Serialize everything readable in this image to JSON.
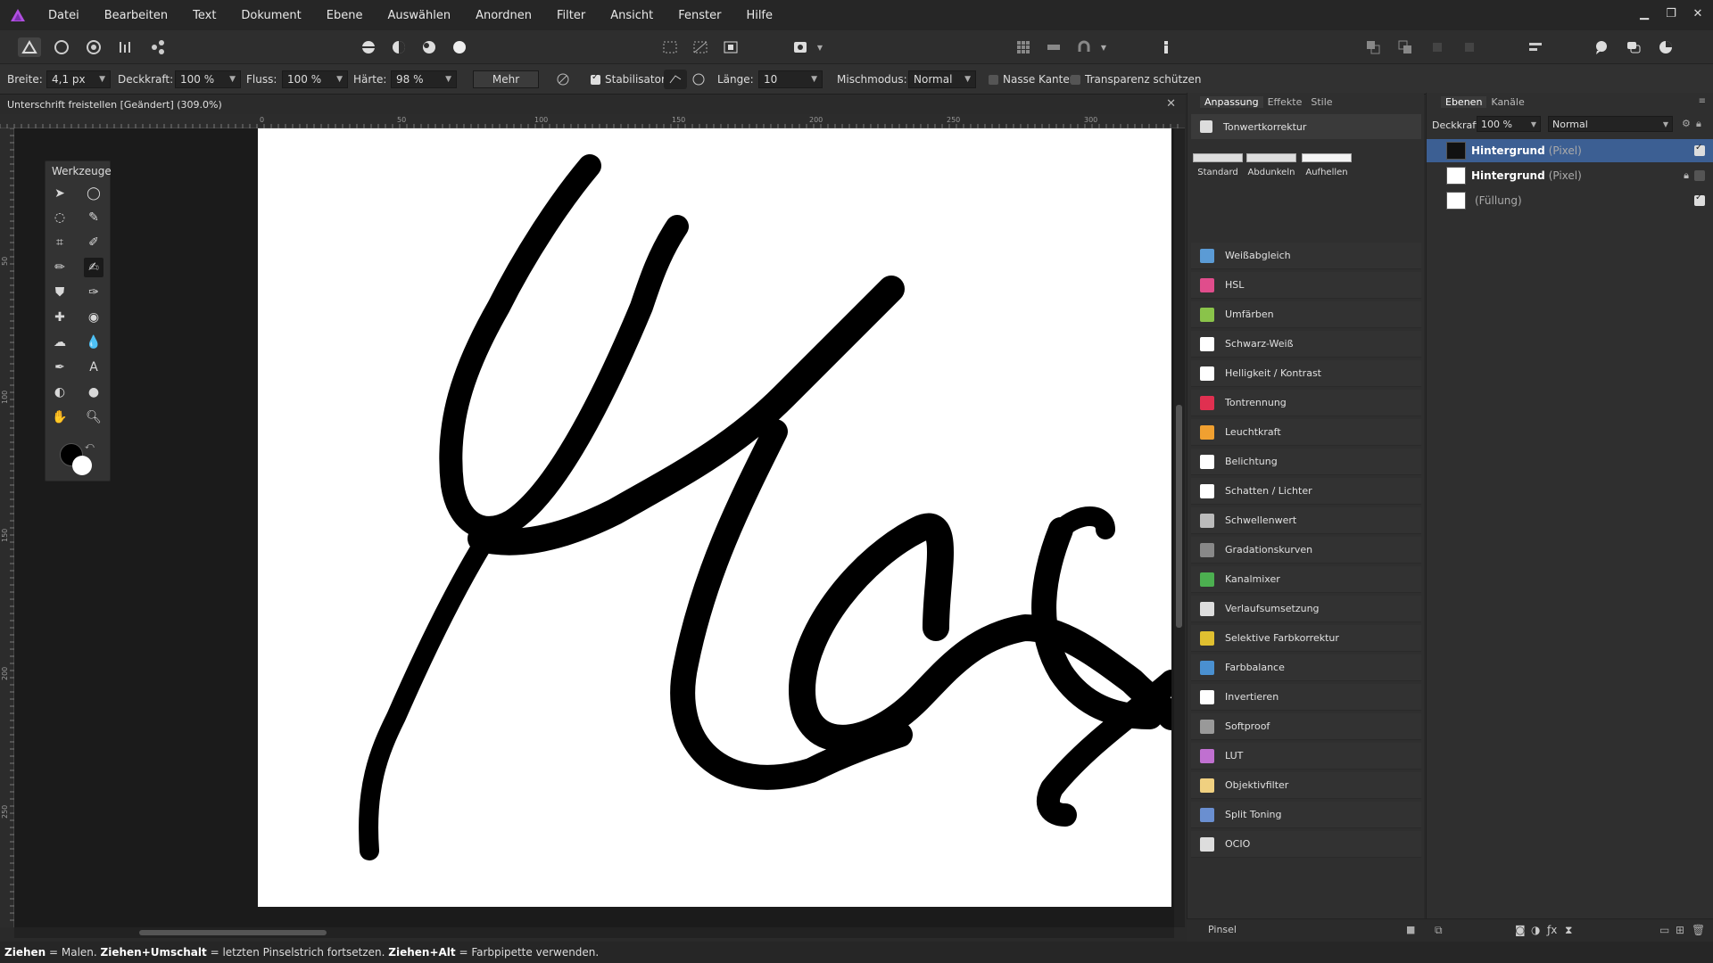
{
  "menubar": {
    "items": [
      "Datei",
      "Bearbeiten",
      "Text",
      "Dokument",
      "Ebene",
      "Auswählen",
      "Anordnen",
      "Filter",
      "Ansicht",
      "Fenster",
      "Hilfe"
    ]
  },
  "context": {
    "width_label": "Breite:",
    "width_value": "4,1 px",
    "opacity_label": "Deckkraft:",
    "opacity_value": "100 %",
    "flow_label": "Fluss:",
    "flow_value": "100 %",
    "hardness_label": "Härte:",
    "hardness_value": "98 %",
    "more_label": "Mehr",
    "stabilizer_label": "Stabilisator",
    "length_label": "Länge:",
    "length_value": "10",
    "blend_label": "Mischmodus:",
    "blend_value": "Normal",
    "wet_edges_label": "Nasse Kanten",
    "protect_alpha_label": "Transparenz schützen"
  },
  "document": {
    "tab_title": "Unterschrift freistellen [Geändert] (309.0%)"
  },
  "rulers": {
    "h_ticks": [
      "0",
      "50",
      "100",
      "150",
      "200",
      "250",
      "300"
    ],
    "v_ticks": [
      "50",
      "100",
      "150",
      "200",
      "250"
    ]
  },
  "tools_panel": {
    "title": "Werkzeuge"
  },
  "adjustment_panel": {
    "tabs": [
      "Anpassung",
      "Effekte",
      "Stile"
    ],
    "header": "Tonwertkorrektur",
    "presets": [
      "Standard",
      "Abdunkeln",
      "Aufhellen"
    ],
    "items": [
      {
        "label": "Weißabgleich",
        "color": "#5b9bd5"
      },
      {
        "label": "HSL",
        "color": "#e04d8c"
      },
      {
        "label": "Umfärben",
        "color": "#8ac34a"
      },
      {
        "label": "Schwarz-Weiß",
        "color": "#ffffff"
      },
      {
        "label": "Helligkeit / Kontrast",
        "color": "#ffffff"
      },
      {
        "label": "Tontrennung",
        "color": "#e03050"
      },
      {
        "label": "Leuchtkraft",
        "color": "#f0a030"
      },
      {
        "label": "Belichtung",
        "color": "#ffffff"
      },
      {
        "label": "Schatten / Lichter",
        "color": "#ffffff"
      },
      {
        "label": "Schwellenwert",
        "color": "#bbbbbb"
      },
      {
        "label": "Gradationskurven",
        "color": "#888888"
      },
      {
        "label": "Kanalmixer",
        "color": "#4caf50"
      },
      {
        "label": "Verlaufsumsetzung",
        "color": "#dddddd"
      },
      {
        "label": "Selektive Farbkorrektur",
        "color": "#e0c030"
      },
      {
        "label": "Farbbalance",
        "color": "#4a90d0"
      },
      {
        "label": "Invertieren",
        "color": "#ffffff"
      },
      {
        "label": "Softproof",
        "color": "#999999"
      },
      {
        "label": "LUT",
        "color": "#c070d0"
      },
      {
        "label": "Objektivfilter",
        "color": "#f0d080"
      },
      {
        "label": "Split Toning",
        "color": "#6a8fd0"
      },
      {
        "label": "OCIO",
        "color": "#dddddd"
      }
    ]
  },
  "layers_panel": {
    "tabs": [
      "Ebenen",
      "Kanäle"
    ],
    "opacity_label": "Deckkraft:",
    "opacity_value": "100 %",
    "blend_value": "Normal",
    "layers": [
      {
        "name": "Hintergrund",
        "type": "(Pixel)",
        "selected": true
      },
      {
        "name": "Hintergrund",
        "type": "(Pixel)",
        "selected": false
      },
      {
        "name": "",
        "type": "(Füllung)",
        "selected": false
      }
    ]
  },
  "bottom": {
    "brush_label": "Pinsel"
  },
  "statusbar": {
    "t1": "Ziehen",
    "t2": " = Malen. ",
    "t3": "Ziehen+Umschalt",
    "t4": " = letzten Pinselstrich fortsetzen. ",
    "t5": "Ziehen+Alt",
    "t6": " = Farbpipette verwenden."
  }
}
